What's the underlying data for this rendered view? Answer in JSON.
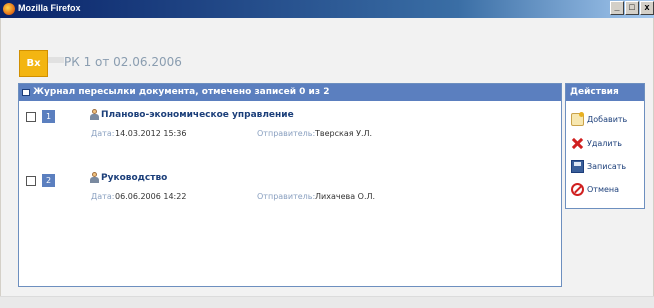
{
  "window": {
    "title": "Mozilla Firefox",
    "buttons": [
      "_",
      "□",
      "x"
    ]
  },
  "header": {
    "badge": "Вх",
    "title": "РК 1 от 02.06.2006"
  },
  "journal": {
    "heading": "Журнал пересылки документа, отмечено записей 0 из 2",
    "date_label": "Дата:",
    "sender_label": "Отправитель:",
    "rows": [
      {
        "num": "1",
        "department": "Планово-экономическое управление",
        "date": "14.03.2012 15:36",
        "sender": "Тверская У.Л."
      },
      {
        "num": "2",
        "department": "Руководство",
        "date": "06.06.2006 14:22",
        "sender": "Лихачева О.Л."
      }
    ]
  },
  "actions": {
    "heading": "Действия",
    "items": [
      {
        "label": "Добавить",
        "icon": "add-icon"
      },
      {
        "label": "Удалить",
        "icon": "delete-icon"
      },
      {
        "label": "Записать",
        "icon": "save-icon"
      },
      {
        "label": "Отмена",
        "icon": "cancel-icon"
      }
    ]
  }
}
